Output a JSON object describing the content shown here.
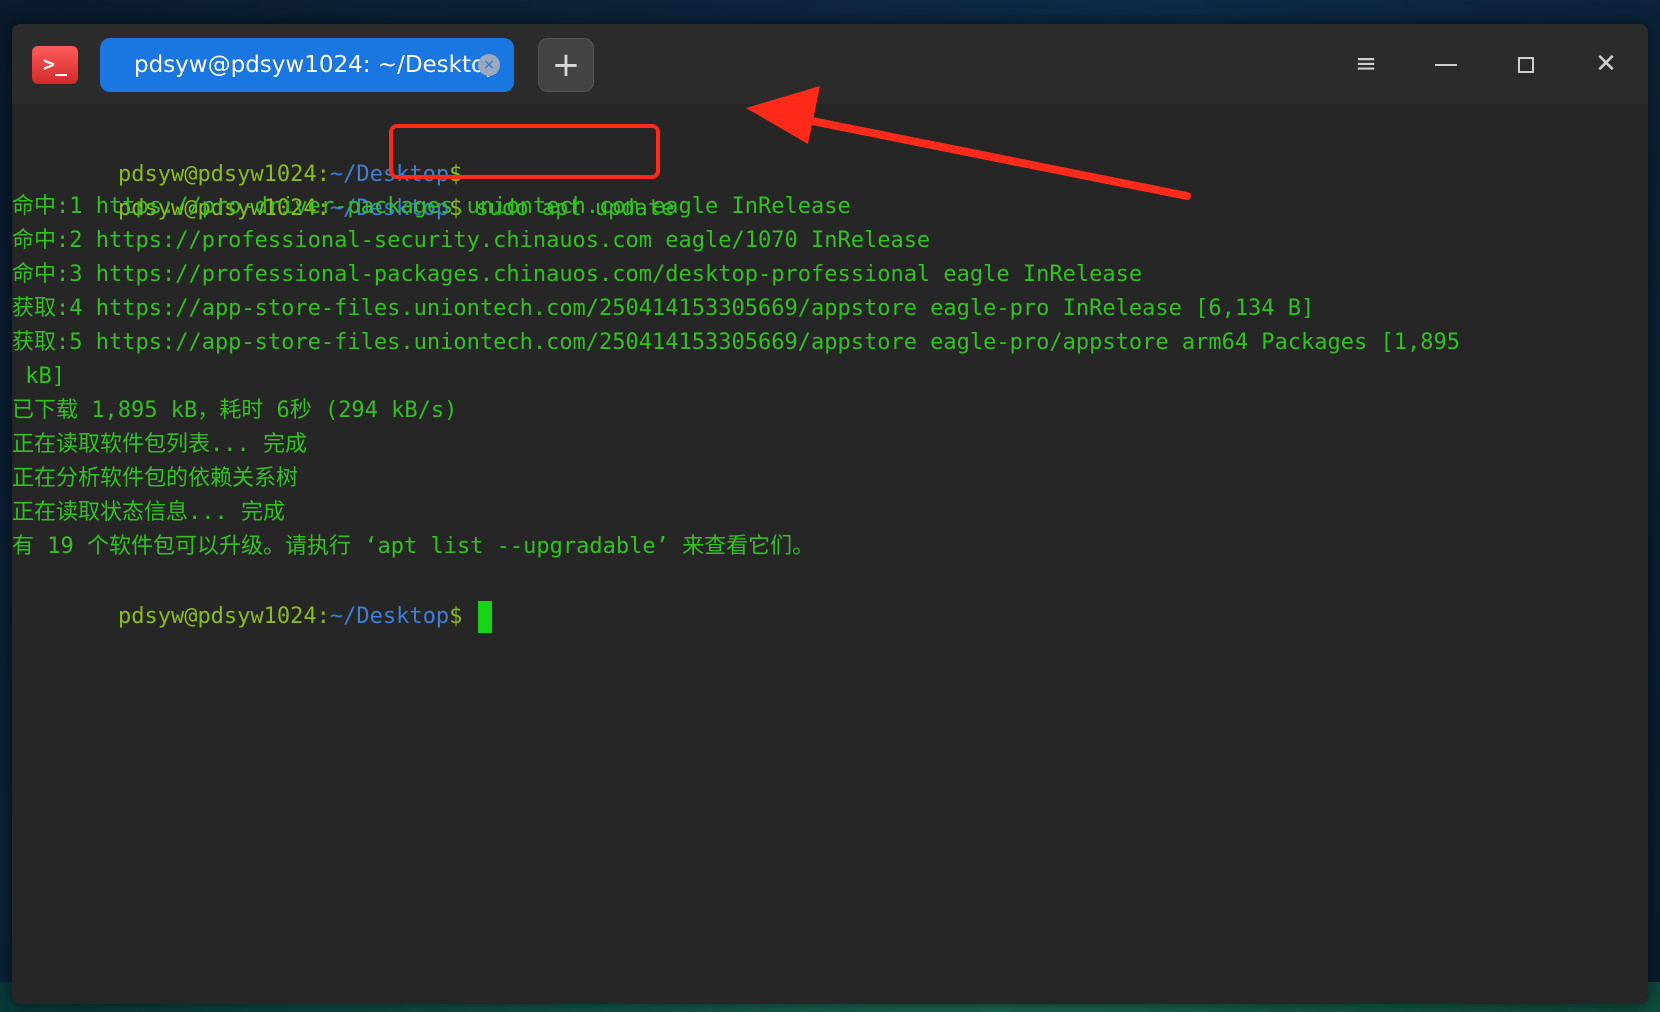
{
  "window": {
    "tab_title": "pdsyw@pdsyw1024: ~/Desktop",
    "app_icon_glyph": ">_",
    "tab_close_glyph": "×",
    "new_tab_glyph": "+",
    "menu_glyph": "≡",
    "close_glyph": "✕"
  },
  "terminal": {
    "prompt_user": "pdsyw@pdsyw1024",
    "prompt_sep": ":",
    "prompt_path": "~/Desktop",
    "prompt_dollar": "$",
    "command": " sudo apt update",
    "output": [
      "命中:1 https://pro-driver-packages.uniontech.com eagle InRelease",
      "命中:2 https://professional-security.chinauos.com eagle/1070 InRelease",
      "命中:3 https://professional-packages.chinauos.com/desktop-professional eagle InRelease",
      "获取:4 https://app-store-files.uniontech.com/250414153305669/appstore eagle-pro InRelease [6,134 B]",
      "获取:5 https://app-store-files.uniontech.com/250414153305669/appstore eagle-pro/appstore arm64 Packages [1,895",
      " kB]",
      "已下载 1,895 kB，耗时 6秒 (294 kB/s)",
      "正在读取软件包列表... 完成",
      "正在分析软件包的依赖关系树",
      "正在读取状态信息... 完成",
      "有 19 个软件包可以升级。请执行 ‘apt list --upgradable’ 来查看它们。"
    ]
  },
  "annotation": {
    "box_color": "#ff2a1a",
    "arrow_color": "#ff2a1a"
  },
  "colors": {
    "terminal_bg": "#262626",
    "tab_bg": "#1a76e0",
    "output_green": "#31c21f",
    "prompt_user": "#8bbd1a",
    "prompt_path": "#3e7fd8"
  }
}
